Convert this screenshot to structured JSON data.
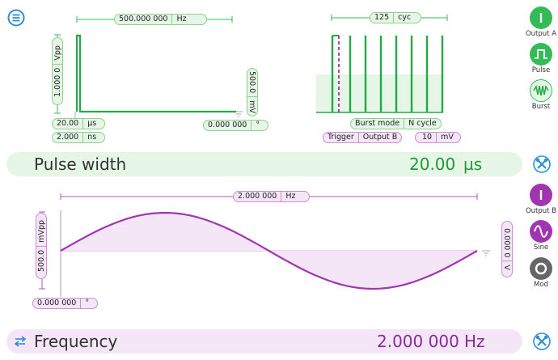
{
  "colors": {
    "green": "#22aa44",
    "green_light": "#e6f6e6",
    "purple": "#a035b0",
    "purple_light": "#f4e6f6",
    "blue": "#2b8fd6"
  },
  "channel_a": {
    "pulse_chart": {
      "period": "500.000 000",
      "period_unit": "Hz",
      "amplitude": "1.000 0",
      "amplitude_unit": "Vpp",
      "offset": "500.0",
      "offset_unit": "mV",
      "width": "20.00",
      "width_unit": "µs",
      "edge": "2.000",
      "edge_unit": "ns",
      "phase": "0.000 000",
      "phase_unit": "°"
    },
    "burst_chart": {
      "count": "125",
      "count_unit": "cyc",
      "mode_label": "Burst mode",
      "mode_value": "N cycle",
      "trigger_label": "Trigger",
      "trigger_value": "Output B",
      "level": "10",
      "level_unit": "mV"
    },
    "param_bar": {
      "label": "Pulse width",
      "value": "20.00",
      "unit": "µs"
    },
    "side": {
      "output": "Output A",
      "wave": "Pulse",
      "burst": "Burst"
    }
  },
  "channel_b": {
    "sine_chart": {
      "period": "2.000 000",
      "period_unit": "Hz",
      "amplitude": "500.0",
      "amplitude_unit": "mVpp",
      "offset": "0.000 0",
      "offset_unit": "V",
      "phase": "0.000 000",
      "phase_unit": "°"
    },
    "param_bar": {
      "label": "Frequency",
      "value": "2.000 000",
      "unit": "Hz"
    },
    "side": {
      "output": "Output B",
      "wave": "Sine",
      "mod": "Mod"
    }
  }
}
